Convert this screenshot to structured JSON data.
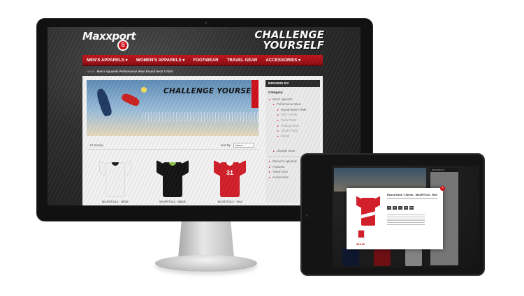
{
  "site": {
    "logo_text": "Maxxport",
    "logo_badge": "S",
    "slogan_line1": "CHALLENGE",
    "slogan_line2": "YOURSELF"
  },
  "nav": {
    "items": [
      {
        "label": "MEN'S APPARELS ▾"
      },
      {
        "label": "WOMEN'S APPARELS ▾"
      },
      {
        "label": "FOOTWEAR"
      },
      {
        "label": "TRAVEL GEAR"
      },
      {
        "label": "ACCESSORIES ▾"
      }
    ]
  },
  "breadcrumb": {
    "home": "Home",
    "separator": " › ",
    "current": "Men's Apparels Performance Wear Round Neck T-Shirt"
  },
  "banner": {
    "title": "CHALLENGE YOURSELF"
  },
  "results": {
    "count_label": "13 Item(s)",
    "sort_label": "Sort By",
    "sort_value": "Name"
  },
  "products": [
    {
      "name": "MAXRTS12 - White",
      "color": "#f2f2f2",
      "accent": "#1a1a1a",
      "number": ""
    },
    {
      "name": "MAXRTS12 - Black",
      "color": "#141414",
      "accent": "#8bc34a",
      "number": ""
    },
    {
      "name": "MAXRTS13 - Red",
      "color": "#d21f2a",
      "accent": "#ffffff",
      "number": "31"
    }
  ],
  "sidebar": {
    "header": "BROWSE BY",
    "category_title": "Category",
    "items": [
      {
        "label": "Men's Apparels",
        "level": 1
      },
      {
        "label": "Performance Wear",
        "level": 2
      },
      {
        "label": "Round Neck T-Shirt",
        "level": 3
      },
      {
        "label": "Polo T-shirts",
        "level": 3
      },
      {
        "label": "Track Pants",
        "level": 3
      },
      {
        "label": "Training Wear",
        "level": 3
      },
      {
        "label": "Shorts Trunk",
        "level": 3
      },
      {
        "label": "Shorts",
        "level": 3
      },
      {
        "label": "Lifestyle Wear",
        "level": 2
      },
      {
        "label": "Women's Apparels",
        "level": 1
      },
      {
        "label": "Footwear",
        "level": 1
      },
      {
        "label": "Travel Gear",
        "level": 1
      },
      {
        "label": "Accessories",
        "level": 1
      }
    ]
  },
  "modal": {
    "title": "Round Neck T-Shirts - MAXRTS13 - Red",
    "close": "×",
    "sizes": [
      "S",
      "M",
      "L",
      "XL",
      "XXL"
    ],
    "price": "$18.00"
  },
  "colors": {
    "brand_red": "#c4141c",
    "nav_dark_red": "#8e0c12",
    "sidebar_head": "#2b2b2b"
  }
}
